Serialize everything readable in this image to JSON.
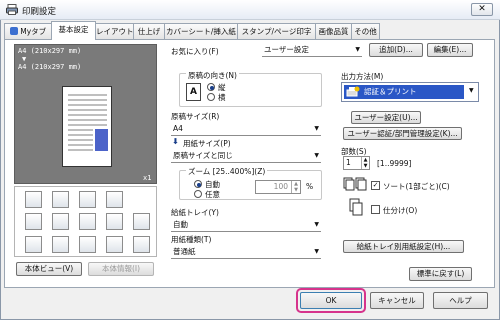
{
  "window": {
    "title": "印刷設定",
    "close": "✕"
  },
  "tabs": [
    "Myタブ",
    "基本設定",
    "レイアウト",
    "仕上げ",
    "カバーシート/挿入紙",
    "スタンプ/ページ印字",
    "画像品質",
    "その他"
  ],
  "preview": {
    "line1": "A4 (210x297 mm)",
    "arrow": "▼",
    "line2": "A4 (210x297 mm)",
    "copies": "x1"
  },
  "preview_buttons": {
    "printer_view": "本体ビュー(V)",
    "printer_info": "本体情報(I)"
  },
  "favorites": {
    "label": "お気に入り(F)",
    "value": "ユーザー設定",
    "add": "追加(D)...",
    "edit": "編集(E)..."
  },
  "orientation": {
    "label": "原稿の向き(N)",
    "portrait": "縦",
    "landscape": "横",
    "selected": "portrait"
  },
  "original_size": {
    "label": "原稿サイズ(R)",
    "value": "A4"
  },
  "paper_size": {
    "label": "用紙サイズ(P)",
    "value": "原稿サイズと同じ"
  },
  "zoom": {
    "label": "ズーム [25..400%](Z)",
    "auto": "自動",
    "manual": "任意",
    "value": "100",
    "unit": "%"
  },
  "paper_tray": {
    "label": "給紙トレイ(Y)",
    "value": "自動"
  },
  "paper_type": {
    "label": "用紙種類(T)",
    "value": "普通紙"
  },
  "output": {
    "label": "出力方法(M)",
    "value": "認証＆プリント",
    "user_settings": "ユーザー設定(U)...",
    "auth_settings": "ユーザー認証/部門管理設定(K)..."
  },
  "copies": {
    "label": "部数(S)",
    "value": "1",
    "range": "[1..9999]"
  },
  "collate": {
    "label": "ソート(1部ごと)(C)",
    "checked": true
  },
  "offset": {
    "label": "仕分け(O)",
    "checked": false
  },
  "tray_paper_settings": "給紙トレイ別用紙設定(H)...",
  "restore_default": "標準に戻す(L)",
  "footer": {
    "ok": "OK",
    "cancel": "キャンセル",
    "help": "ヘルプ"
  },
  "colors": {
    "highlight": "#d6338c",
    "accent": "#1a3f8a",
    "output_icon_bg": "#2a57c6"
  }
}
